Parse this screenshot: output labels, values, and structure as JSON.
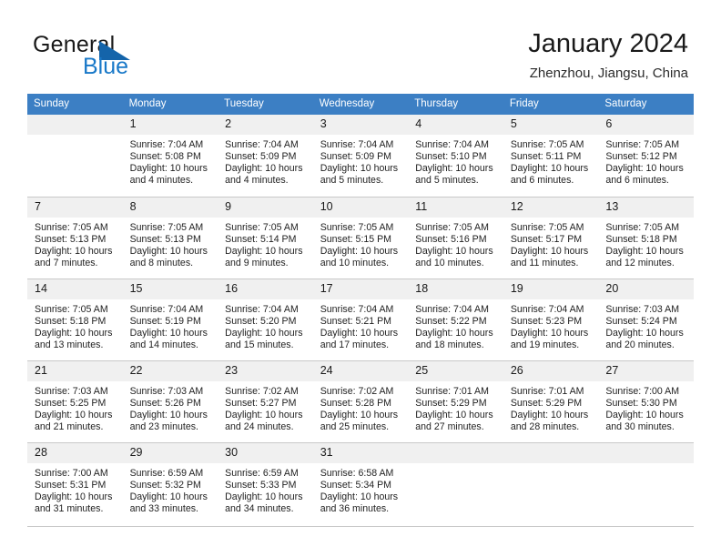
{
  "brand": {
    "name_part1": "General",
    "name_part2": "Blue",
    "logo_icon": "triangle-icon",
    "accent_color": "#1878c8",
    "dark_blue": "#1464aa"
  },
  "header": {
    "title": "January 2024",
    "subtitle": "Zhenzhou, Jiangsu, China"
  },
  "calendar": {
    "header_bg": "#3c7fc4",
    "daynum_bg": "#f0f0f0",
    "weekday_headers": [
      "Sunday",
      "Monday",
      "Tuesday",
      "Wednesday",
      "Thursday",
      "Friday",
      "Saturday"
    ],
    "weeks": [
      {
        "days": [
          {
            "num": "",
            "sunrise": "",
            "sunset": "",
            "daylight_1": "",
            "daylight_2": "",
            "empty": true
          },
          {
            "num": "1",
            "sunrise": "Sunrise: 7:04 AM",
            "sunset": "Sunset: 5:08 PM",
            "daylight_1": "Daylight: 10 hours",
            "daylight_2": "and 4 minutes."
          },
          {
            "num": "2",
            "sunrise": "Sunrise: 7:04 AM",
            "sunset": "Sunset: 5:09 PM",
            "daylight_1": "Daylight: 10 hours",
            "daylight_2": "and 4 minutes."
          },
          {
            "num": "3",
            "sunrise": "Sunrise: 7:04 AM",
            "sunset": "Sunset: 5:09 PM",
            "daylight_1": "Daylight: 10 hours",
            "daylight_2": "and 5 minutes."
          },
          {
            "num": "4",
            "sunrise": "Sunrise: 7:04 AM",
            "sunset": "Sunset: 5:10 PM",
            "daylight_1": "Daylight: 10 hours",
            "daylight_2": "and 5 minutes."
          },
          {
            "num": "5",
            "sunrise": "Sunrise: 7:05 AM",
            "sunset": "Sunset: 5:11 PM",
            "daylight_1": "Daylight: 10 hours",
            "daylight_2": "and 6 minutes."
          },
          {
            "num": "6",
            "sunrise": "Sunrise: 7:05 AM",
            "sunset": "Sunset: 5:12 PM",
            "daylight_1": "Daylight: 10 hours",
            "daylight_2": "and 6 minutes."
          }
        ]
      },
      {
        "days": [
          {
            "num": "7",
            "sunrise": "Sunrise: 7:05 AM",
            "sunset": "Sunset: 5:13 PM",
            "daylight_1": "Daylight: 10 hours",
            "daylight_2": "and 7 minutes."
          },
          {
            "num": "8",
            "sunrise": "Sunrise: 7:05 AM",
            "sunset": "Sunset: 5:13 PM",
            "daylight_1": "Daylight: 10 hours",
            "daylight_2": "and 8 minutes."
          },
          {
            "num": "9",
            "sunrise": "Sunrise: 7:05 AM",
            "sunset": "Sunset: 5:14 PM",
            "daylight_1": "Daylight: 10 hours",
            "daylight_2": "and 9 minutes."
          },
          {
            "num": "10",
            "sunrise": "Sunrise: 7:05 AM",
            "sunset": "Sunset: 5:15 PM",
            "daylight_1": "Daylight: 10 hours",
            "daylight_2": "and 10 minutes."
          },
          {
            "num": "11",
            "sunrise": "Sunrise: 7:05 AM",
            "sunset": "Sunset: 5:16 PM",
            "daylight_1": "Daylight: 10 hours",
            "daylight_2": "and 10 minutes."
          },
          {
            "num": "12",
            "sunrise": "Sunrise: 7:05 AM",
            "sunset": "Sunset: 5:17 PM",
            "daylight_1": "Daylight: 10 hours",
            "daylight_2": "and 11 minutes."
          },
          {
            "num": "13",
            "sunrise": "Sunrise: 7:05 AM",
            "sunset": "Sunset: 5:18 PM",
            "daylight_1": "Daylight: 10 hours",
            "daylight_2": "and 12 minutes."
          }
        ]
      },
      {
        "days": [
          {
            "num": "14",
            "sunrise": "Sunrise: 7:05 AM",
            "sunset": "Sunset: 5:18 PM",
            "daylight_1": "Daylight: 10 hours",
            "daylight_2": "and 13 minutes."
          },
          {
            "num": "15",
            "sunrise": "Sunrise: 7:04 AM",
            "sunset": "Sunset: 5:19 PM",
            "daylight_1": "Daylight: 10 hours",
            "daylight_2": "and 14 minutes."
          },
          {
            "num": "16",
            "sunrise": "Sunrise: 7:04 AM",
            "sunset": "Sunset: 5:20 PM",
            "daylight_1": "Daylight: 10 hours",
            "daylight_2": "and 15 minutes."
          },
          {
            "num": "17",
            "sunrise": "Sunrise: 7:04 AM",
            "sunset": "Sunset: 5:21 PM",
            "daylight_1": "Daylight: 10 hours",
            "daylight_2": "and 17 minutes."
          },
          {
            "num": "18",
            "sunrise": "Sunrise: 7:04 AM",
            "sunset": "Sunset: 5:22 PM",
            "daylight_1": "Daylight: 10 hours",
            "daylight_2": "and 18 minutes."
          },
          {
            "num": "19",
            "sunrise": "Sunrise: 7:04 AM",
            "sunset": "Sunset: 5:23 PM",
            "daylight_1": "Daylight: 10 hours",
            "daylight_2": "and 19 minutes."
          },
          {
            "num": "20",
            "sunrise": "Sunrise: 7:03 AM",
            "sunset": "Sunset: 5:24 PM",
            "daylight_1": "Daylight: 10 hours",
            "daylight_2": "and 20 minutes."
          }
        ]
      },
      {
        "days": [
          {
            "num": "21",
            "sunrise": "Sunrise: 7:03 AM",
            "sunset": "Sunset: 5:25 PM",
            "daylight_1": "Daylight: 10 hours",
            "daylight_2": "and 21 minutes."
          },
          {
            "num": "22",
            "sunrise": "Sunrise: 7:03 AM",
            "sunset": "Sunset: 5:26 PM",
            "daylight_1": "Daylight: 10 hours",
            "daylight_2": "and 23 minutes."
          },
          {
            "num": "23",
            "sunrise": "Sunrise: 7:02 AM",
            "sunset": "Sunset: 5:27 PM",
            "daylight_1": "Daylight: 10 hours",
            "daylight_2": "and 24 minutes."
          },
          {
            "num": "24",
            "sunrise": "Sunrise: 7:02 AM",
            "sunset": "Sunset: 5:28 PM",
            "daylight_1": "Daylight: 10 hours",
            "daylight_2": "and 25 minutes."
          },
          {
            "num": "25",
            "sunrise": "Sunrise: 7:01 AM",
            "sunset": "Sunset: 5:29 PM",
            "daylight_1": "Daylight: 10 hours",
            "daylight_2": "and 27 minutes."
          },
          {
            "num": "26",
            "sunrise": "Sunrise: 7:01 AM",
            "sunset": "Sunset: 5:29 PM",
            "daylight_1": "Daylight: 10 hours",
            "daylight_2": "and 28 minutes."
          },
          {
            "num": "27",
            "sunrise": "Sunrise: 7:00 AM",
            "sunset": "Sunset: 5:30 PM",
            "daylight_1": "Daylight: 10 hours",
            "daylight_2": "and 30 minutes."
          }
        ]
      },
      {
        "days": [
          {
            "num": "28",
            "sunrise": "Sunrise: 7:00 AM",
            "sunset": "Sunset: 5:31 PM",
            "daylight_1": "Daylight: 10 hours",
            "daylight_2": "and 31 minutes."
          },
          {
            "num": "29",
            "sunrise": "Sunrise: 6:59 AM",
            "sunset": "Sunset: 5:32 PM",
            "daylight_1": "Daylight: 10 hours",
            "daylight_2": "and 33 minutes."
          },
          {
            "num": "30",
            "sunrise": "Sunrise: 6:59 AM",
            "sunset": "Sunset: 5:33 PM",
            "daylight_1": "Daylight: 10 hours",
            "daylight_2": "and 34 minutes."
          },
          {
            "num": "31",
            "sunrise": "Sunrise: 6:58 AM",
            "sunset": "Sunset: 5:34 PM",
            "daylight_1": "Daylight: 10 hours",
            "daylight_2": "and 36 minutes."
          },
          {
            "num": "",
            "sunrise": "",
            "sunset": "",
            "daylight_1": "",
            "daylight_2": "",
            "empty": true
          },
          {
            "num": "",
            "sunrise": "",
            "sunset": "",
            "daylight_1": "",
            "daylight_2": "",
            "empty": true
          },
          {
            "num": "",
            "sunrise": "",
            "sunset": "",
            "daylight_1": "",
            "daylight_2": "",
            "empty": true
          }
        ]
      }
    ]
  }
}
